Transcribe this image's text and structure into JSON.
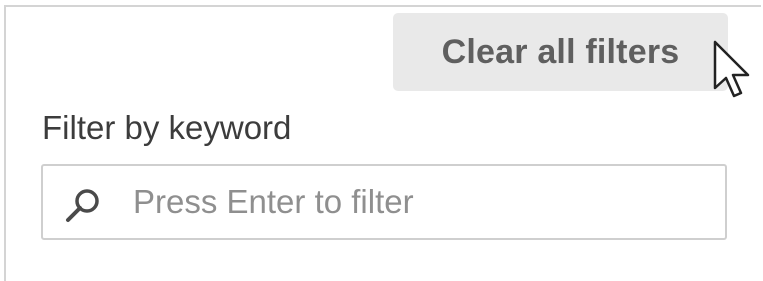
{
  "toolbar": {
    "clear_label": "Clear all filters"
  },
  "filter": {
    "label": "Filter by keyword",
    "value": "",
    "placeholder": "Press Enter to filter",
    "icon": "search-icon"
  }
}
